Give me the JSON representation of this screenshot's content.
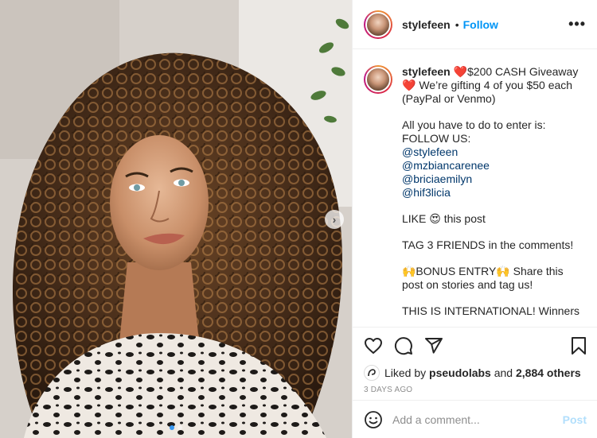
{
  "photo": {
    "alt_semantic": "portrait-photo"
  },
  "header": {
    "username": "stylefeen",
    "separator": "•",
    "follow_label": "Follow",
    "more_label": "•••"
  },
  "caption": {
    "username": "stylefeen",
    "line1": "❤️$200 CASH Giveaway ❤️ We’re gifting 4 of you $50 each (PayPal or Venmo)",
    "line2": "All you have to do to enter is:",
    "follow_us": "FOLLOW US:",
    "mentions": [
      "@stylefeen",
      "@mzbiancarenee",
      "@briciaemilyn",
      "@hif3licia"
    ],
    "like_line": "LIKE 😍 this post",
    "tag_line": "TAG 3 FRIENDS in the comments!",
    "bonus_line": "🙌BONUS ENTRY🙌 Share this post on stories and tag us!",
    "intl_line": "THIS IS INTERNATIONAL! Winners will be announced HERE! Good luck"
  },
  "likes": {
    "prefix": "Liked by",
    "liker": "pseudolabs",
    "middle": "and",
    "others": "2,884 others"
  },
  "timestamp": "3 DAYS AGO",
  "comment": {
    "placeholder": "Add a comment...",
    "post_label": "Post"
  },
  "colors": {
    "accent": "#0095f6",
    "mention": "#00376b",
    "post_disabled": "#b2dffc",
    "muted": "#8e8e8e"
  }
}
